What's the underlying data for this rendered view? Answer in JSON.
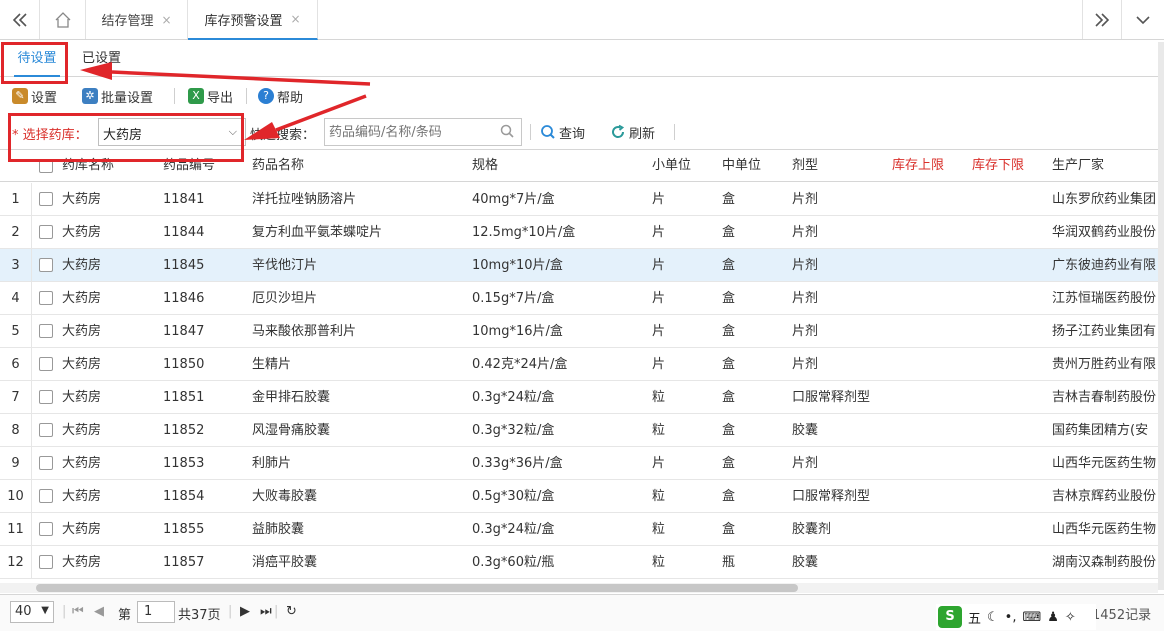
{
  "topbar": {
    "tabs": [
      {
        "label": "结存管理",
        "close": "×"
      },
      {
        "label": "库存预警设置",
        "close": "×"
      }
    ]
  },
  "subtabs": [
    {
      "label": "待设置",
      "active": true
    },
    {
      "label": "已设置",
      "active": false
    }
  ],
  "toolbar": {
    "settings": "设置",
    "batch": "批量设置",
    "export": "导出",
    "help": "帮助"
  },
  "filter": {
    "store_label": "* 选择药库：",
    "store_value": "大药房",
    "search_label": "快速搜索：",
    "search_placeholder": "药品编码/名称/条码",
    "query": "查询",
    "refresh": "刷新"
  },
  "table": {
    "columns": [
      "药库名称",
      "药品编号",
      "药品名称",
      "规格",
      "小单位",
      "中单位",
      "剂型",
      "库存上限",
      "库存下限",
      "生产厂家"
    ],
    "rows": [
      {
        "n": "1",
        "store": "大药房",
        "code": "11841",
        "name": "洋托拉唑钠肠溶片",
        "spec": "40mg*7片/盒",
        "small": "片",
        "mid": "盒",
        "form": "片剂",
        "maker": "山东罗欣药业集团"
      },
      {
        "n": "2",
        "store": "大药房",
        "code": "11844",
        "name": "复方利血平氨苯蝶啶片",
        "spec": "12.5mg*10片/盒",
        "small": "片",
        "mid": "盒",
        "form": "片剂",
        "maker": "华润双鹤药业股份"
      },
      {
        "n": "3",
        "store": "大药房",
        "code": "11845",
        "name": "辛伐他汀片",
        "spec": "10mg*10片/盒",
        "small": "片",
        "mid": "盒",
        "form": "片剂",
        "maker": "广东彼迪药业有限"
      },
      {
        "n": "4",
        "store": "大药房",
        "code": "11846",
        "name": "厄贝沙坦片",
        "spec": "0.15g*7片/盒",
        "small": "片",
        "mid": "盒",
        "form": "片剂",
        "maker": "江苏恒瑞医药股份"
      },
      {
        "n": "5",
        "store": "大药房",
        "code": "11847",
        "name": "马来酸依那普利片",
        "spec": "10mg*16片/盒",
        "small": "片",
        "mid": "盒",
        "form": "片剂",
        "maker": "扬子江药业集团有"
      },
      {
        "n": "6",
        "store": "大药房",
        "code": "11850",
        "name": "生精片",
        "spec": "0.42克*24片/盒",
        "small": "片",
        "mid": "盒",
        "form": "片剂",
        "maker": "贵州万胜药业有限"
      },
      {
        "n": "7",
        "store": "大药房",
        "code": "11851",
        "name": "金甲排石胶囊",
        "spec": "0.3g*24粒/盒",
        "small": "粒",
        "mid": "盒",
        "form": "口服常释剂型",
        "maker": "吉林吉春制药股份"
      },
      {
        "n": "8",
        "store": "大药房",
        "code": "11852",
        "name": "风湿骨痛胶囊",
        "spec": "0.3g*32粒/盒",
        "small": "粒",
        "mid": "盒",
        "form": "胶囊",
        "maker": "国药集团精方(安"
      },
      {
        "n": "9",
        "store": "大药房",
        "code": "11853",
        "name": "利肺片",
        "spec": "0.33g*36片/盒",
        "small": "片",
        "mid": "盒",
        "form": "片剂",
        "maker": "山西华元医药生物"
      },
      {
        "n": "10",
        "store": "大药房",
        "code": "11854",
        "name": "大败毒胶囊",
        "spec": "0.5g*30粒/盒",
        "small": "粒",
        "mid": "盒",
        "form": "口服常释剂型",
        "maker": "吉林京辉药业股份"
      },
      {
        "n": "11",
        "store": "大药房",
        "code": "11855",
        "name": "益肺胶囊",
        "spec": "0.3g*24粒/盒",
        "small": "粒",
        "mid": "盒",
        "form": "胶囊剂",
        "maker": "山西华元医药生物"
      },
      {
        "n": "12",
        "store": "大药房",
        "code": "11857",
        "name": "消癌平胶囊",
        "spec": "0.3g*60粒/瓶",
        "small": "粒",
        "mid": "瓶",
        "form": "胶囊",
        "maker": "湖南汉森制药股份"
      }
    ]
  },
  "pager": {
    "page_size": "40",
    "page_prefix": "第",
    "page_value": "1",
    "page_total": "共37页",
    "record_text": "1452记录"
  },
  "ime": {
    "logo": "S",
    "mode": "五"
  },
  "colors": {
    "accent": "#2b8ad8",
    "annotation": "#e0262a",
    "required": "#d9302b",
    "selected_row": "#e4f1fb"
  }
}
